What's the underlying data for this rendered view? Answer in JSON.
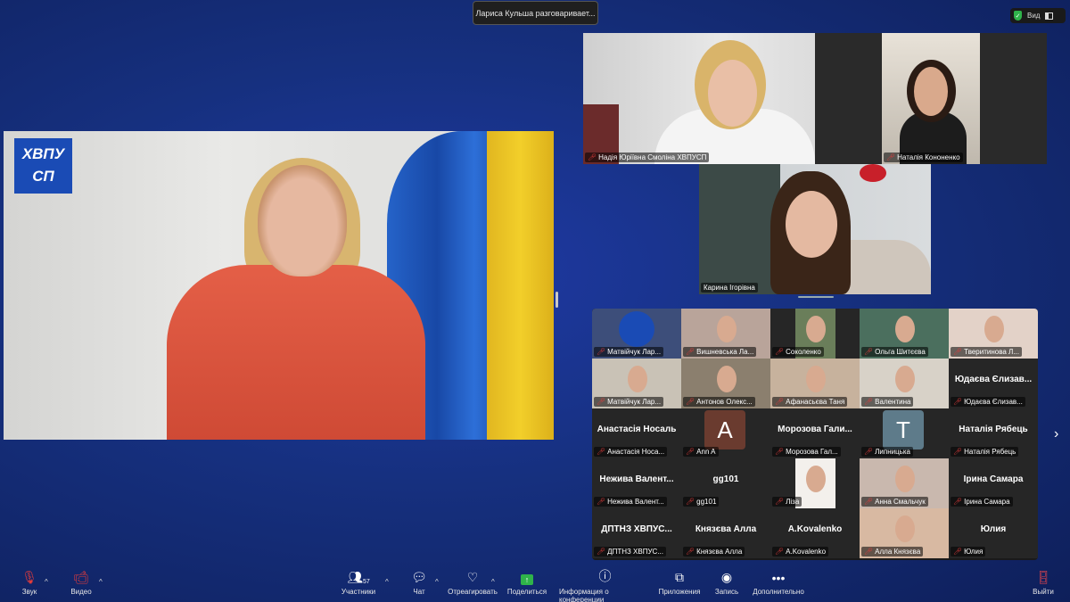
{
  "notification": "Лариса Кульша разговаривает...",
  "view_label": "Вид",
  "speaker": {
    "logo_text_1": "ХВПУ",
    "logo_text_2": "СП"
  },
  "top_tiles": [
    {
      "name": "Надія Юріївна Смоліна ХВПУСП"
    },
    {
      "name": "Наталія Кононенко"
    },
    {
      "name": "Карина Ігорівна"
    }
  ],
  "gallery": [
    {
      "label": "Матвійчук Лар...",
      "big": ""
    },
    {
      "label": "Вишневська Ла...",
      "big": ""
    },
    {
      "label": "Соколенко",
      "big": ""
    },
    {
      "label": "Ольга Шитєєва",
      "big": ""
    },
    {
      "label": "Тверитинова Л...",
      "big": ""
    },
    {
      "label": "Матвійчук Лар...",
      "big": ""
    },
    {
      "label": "Антонов Олекс...",
      "big": ""
    },
    {
      "label": "Афанасьєва Таня",
      "big": ""
    },
    {
      "label": "Валентина",
      "big": ""
    },
    {
      "label": "Юдаєва Єлизав...",
      "big": "Юдаєва Єлизав..."
    },
    {
      "label": "Анастасія Носа...",
      "big": "Анастасія Носаль"
    },
    {
      "label": "Ann A",
      "big": "",
      "avatar": "A"
    },
    {
      "label": "Морозова Гал...",
      "big": "Морозова Гали..."
    },
    {
      "label": "Липницька",
      "big": "",
      "avatar": "T"
    },
    {
      "label": "Наталія Рябець",
      "big": "Наталія Рябець"
    },
    {
      "label": "Нежива Валент...",
      "big": "Нежива Валент..."
    },
    {
      "label": "gg101",
      "big": "gg101"
    },
    {
      "label": "Ліза",
      "big": ""
    },
    {
      "label": "Анна Смальчук",
      "big": ""
    },
    {
      "label": "Ірина Самара",
      "big": "Ірина Самара"
    },
    {
      "label": "ДПТНЗ ХВПУС...",
      "big": "ДПТНЗ ХВПУС..."
    },
    {
      "label": "Князєва Алла",
      "big": "Князєва Алла"
    },
    {
      "label": "A.Kovalenko",
      "big": "A.Kovalenko"
    },
    {
      "label": "Алла Князєва",
      "big": ""
    },
    {
      "label": "Юлия",
      "big": "Юлия"
    }
  ],
  "toolbar": {
    "mute": "Звук",
    "video": "Видео",
    "participants": "Участники",
    "participants_count": "57",
    "chat": "Чат",
    "react": "Отреагировать",
    "share": "Поделиться",
    "info": "Информация о конференции",
    "apps": "Приложения",
    "record": "Запись",
    "more": "Дополнительно",
    "leave": "Выйти"
  },
  "icons": {
    "mute": "mic-off-icon",
    "video": "video-off-icon",
    "participants": "people-icon",
    "chat": "chat-icon",
    "react": "heart-icon",
    "share": "share-arrow-icon",
    "info": "info-icon",
    "apps": "apps-icon",
    "record": "record-icon",
    "more": "more-icon",
    "leave": "door-icon",
    "security": "shield-icon"
  },
  "colors": {
    "accent_green": "#2fb34a",
    "mute_red": "#e03b3b",
    "background_blue": "#16307f"
  }
}
